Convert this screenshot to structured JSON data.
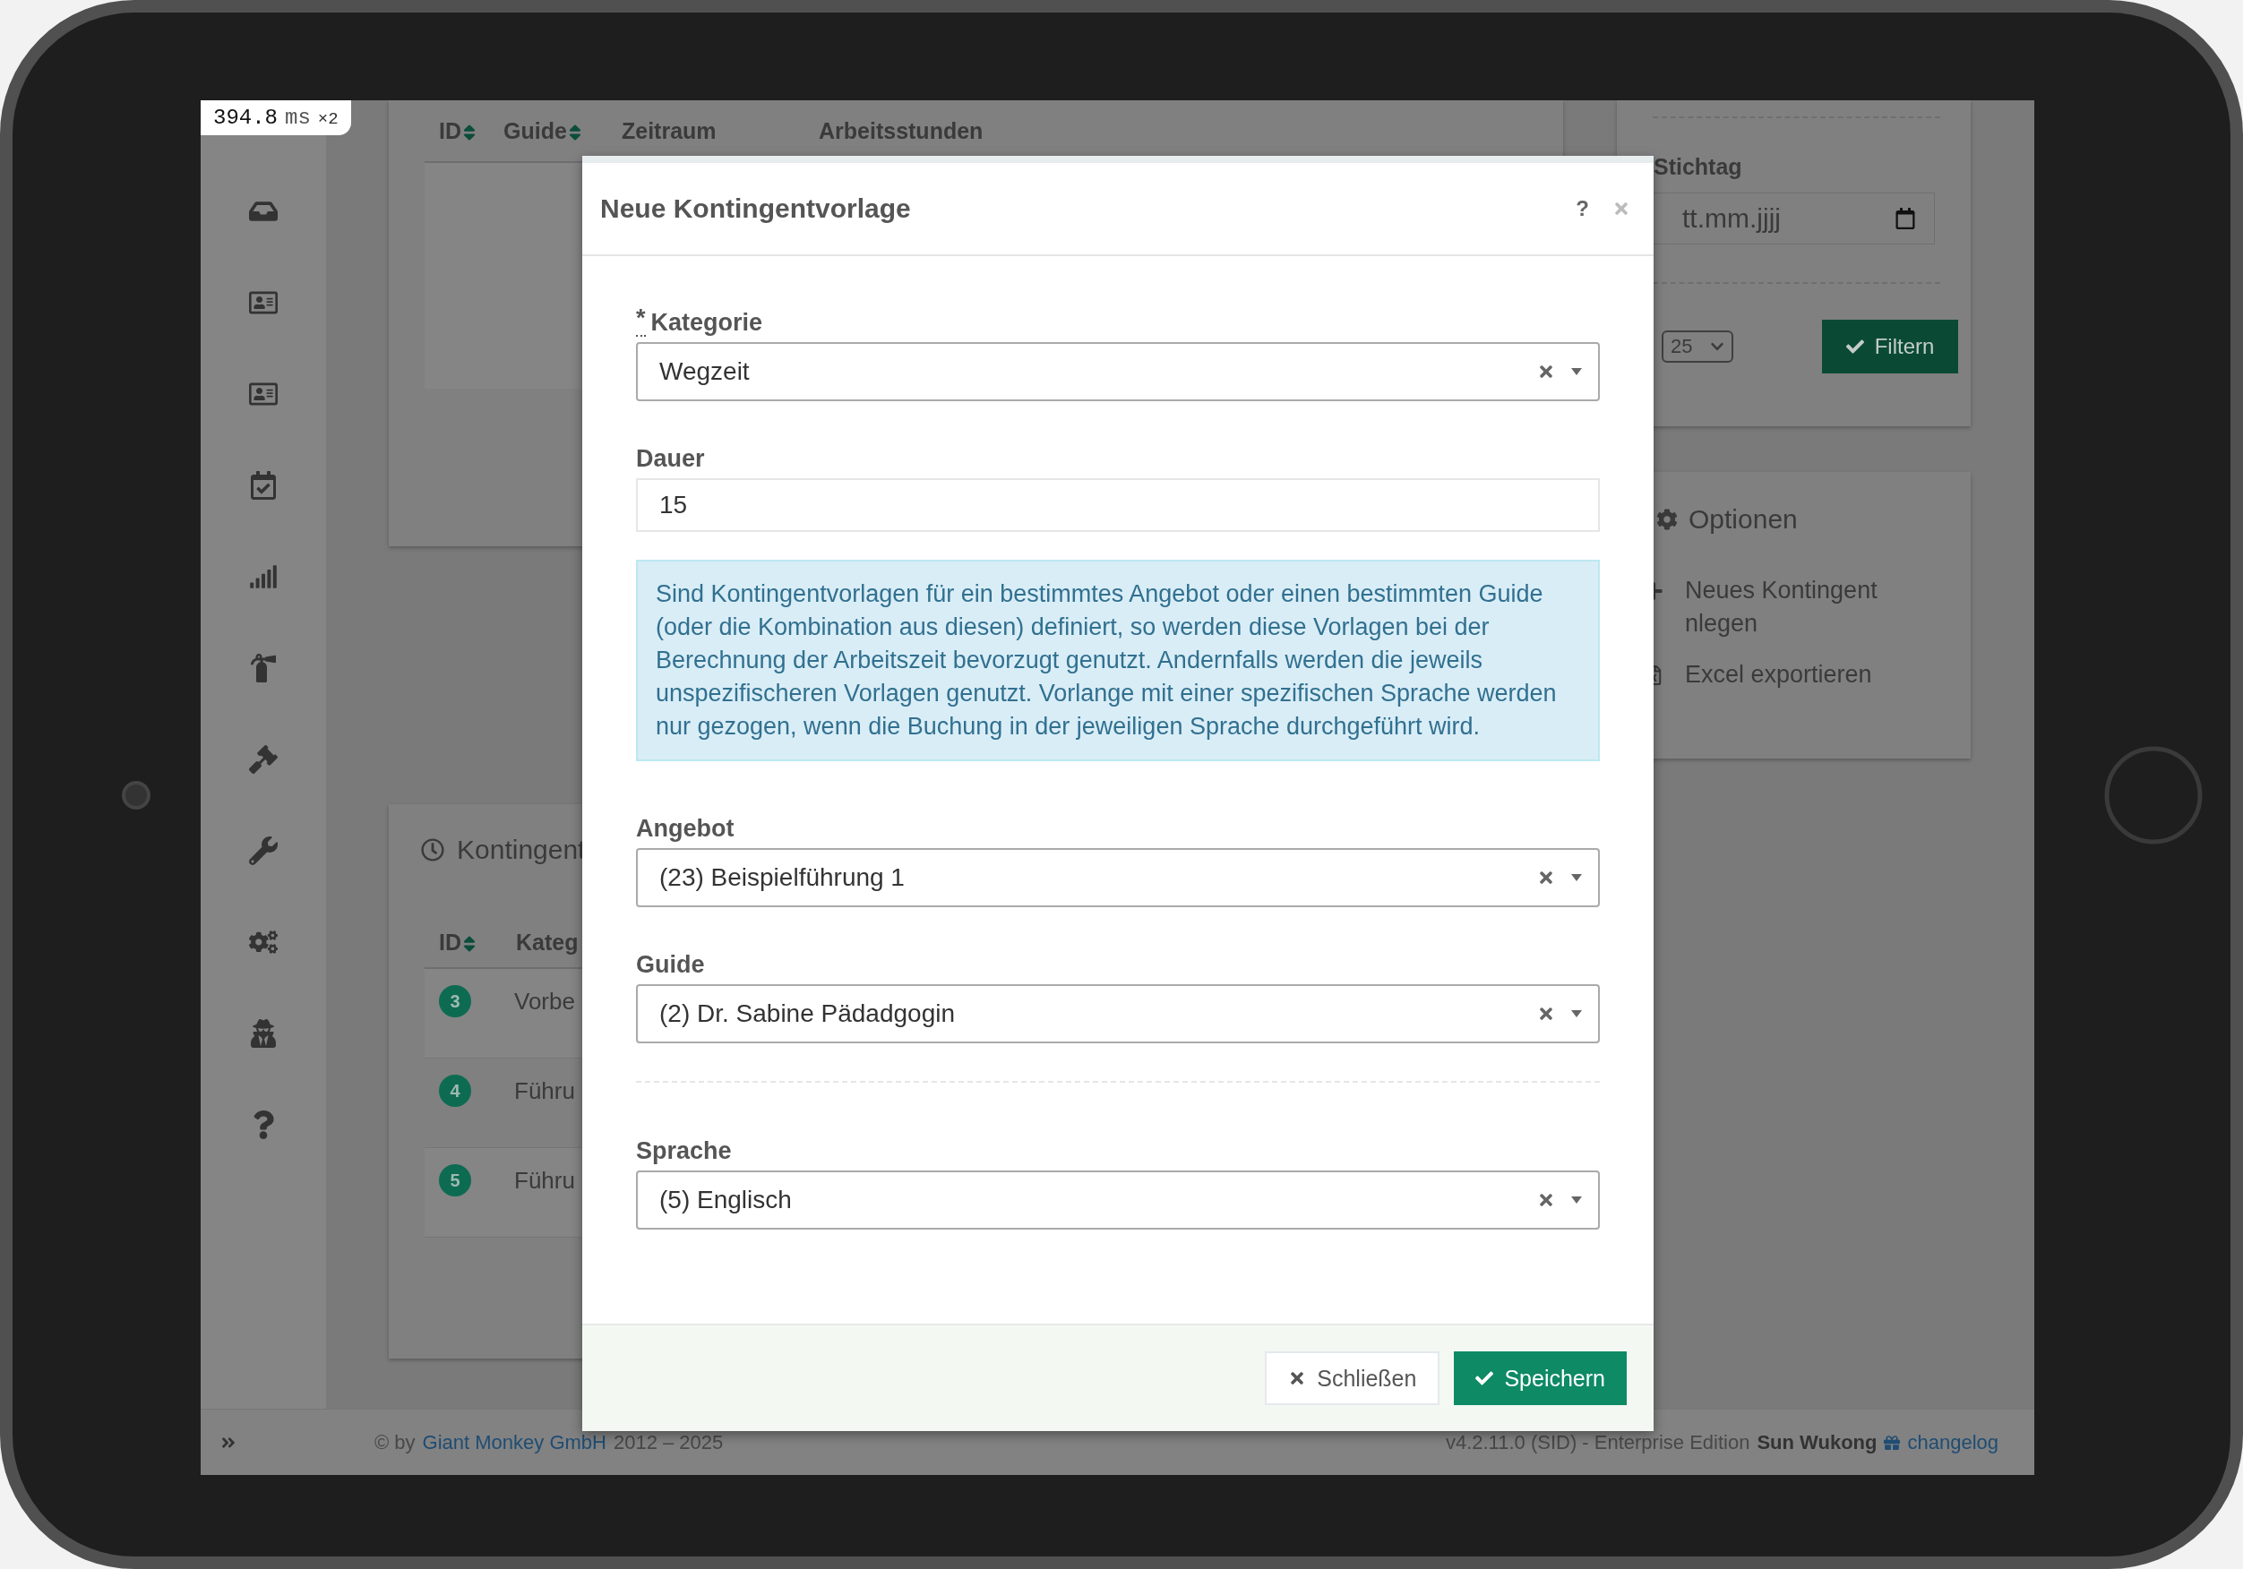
{
  "perf_badge": {
    "value": "394.8",
    "unit": "ms",
    "multiplier": "×2"
  },
  "top_table": {
    "columns": [
      {
        "label": "ID",
        "sortable": true
      },
      {
        "label": "Guide",
        "sortable": true
      },
      {
        "label": "Zeitraum",
        "sortable": false
      },
      {
        "label": "Arbeitsstunden",
        "sortable": false
      }
    ]
  },
  "kontingent_card": {
    "title": "Kontingent",
    "columns": [
      {
        "label": "ID",
        "sortable": true
      },
      {
        "label": "Kateg",
        "sortable": false
      }
    ],
    "rows": [
      {
        "id": "3",
        "category": "Vorbe"
      },
      {
        "id": "4",
        "category": "Führu"
      },
      {
        "id": "5",
        "category": "Führu"
      }
    ]
  },
  "filter_card": {
    "date_label": "Stichtag",
    "date_placeholder": "tt.mm.jjjj",
    "page_size": "25",
    "filter_button": "Filtern"
  },
  "options_card": {
    "title": "Optionen",
    "items": [
      {
        "kind": "create",
        "label": "Neues Kontingent nlegen"
      },
      {
        "kind": "export",
        "label": "Excel exportieren"
      }
    ]
  },
  "footer": {
    "copyright": "© by",
    "company_link": "Giant Monkey GmbH",
    "years": "2012 – 2025",
    "version": "v4.2.11.0 (SID) - Enterprise Edition",
    "edition_name": "Sun Wukong",
    "changelog_link": "changelog"
  },
  "modal": {
    "title": "Neue Kontingentvorlage",
    "help": "?",
    "fields": [
      {
        "kind": "select",
        "label": "Kategorie",
        "required_mark": "*",
        "value": "Wegzeit"
      },
      {
        "kind": "input",
        "label": "Dauer",
        "value": "15"
      },
      {
        "kind": "info",
        "text": "Sind Kontingentvorlagen für ein bestimmtes Angebot oder einen bestimmten Guide (oder die Kombination aus diesen) definiert, so werden diese Vorlagen bei der Berechnung der Arbeitszeit bevorzugt genutzt. Andernfalls werden die jeweils unspezifischeren Vorlagen genutzt. Vorlange mit einer spezifischen Sprache werden nur gezogen, wenn die Buchung in der jeweiligen Sprache durchgeführt wird."
      },
      {
        "kind": "select",
        "label": "Angebot",
        "value": "(23) Beispielführung 1"
      },
      {
        "kind": "select",
        "label": "Guide",
        "value": "(2) Dr. Sabine Pädadgogin"
      },
      {
        "kind": "divider"
      },
      {
        "kind": "select",
        "label": "Sprache",
        "value": "(5) Englisch"
      }
    ],
    "buttons": [
      {
        "kind": "close",
        "label": "Schließen"
      },
      {
        "kind": "save",
        "label": "Speichern"
      }
    ]
  }
}
